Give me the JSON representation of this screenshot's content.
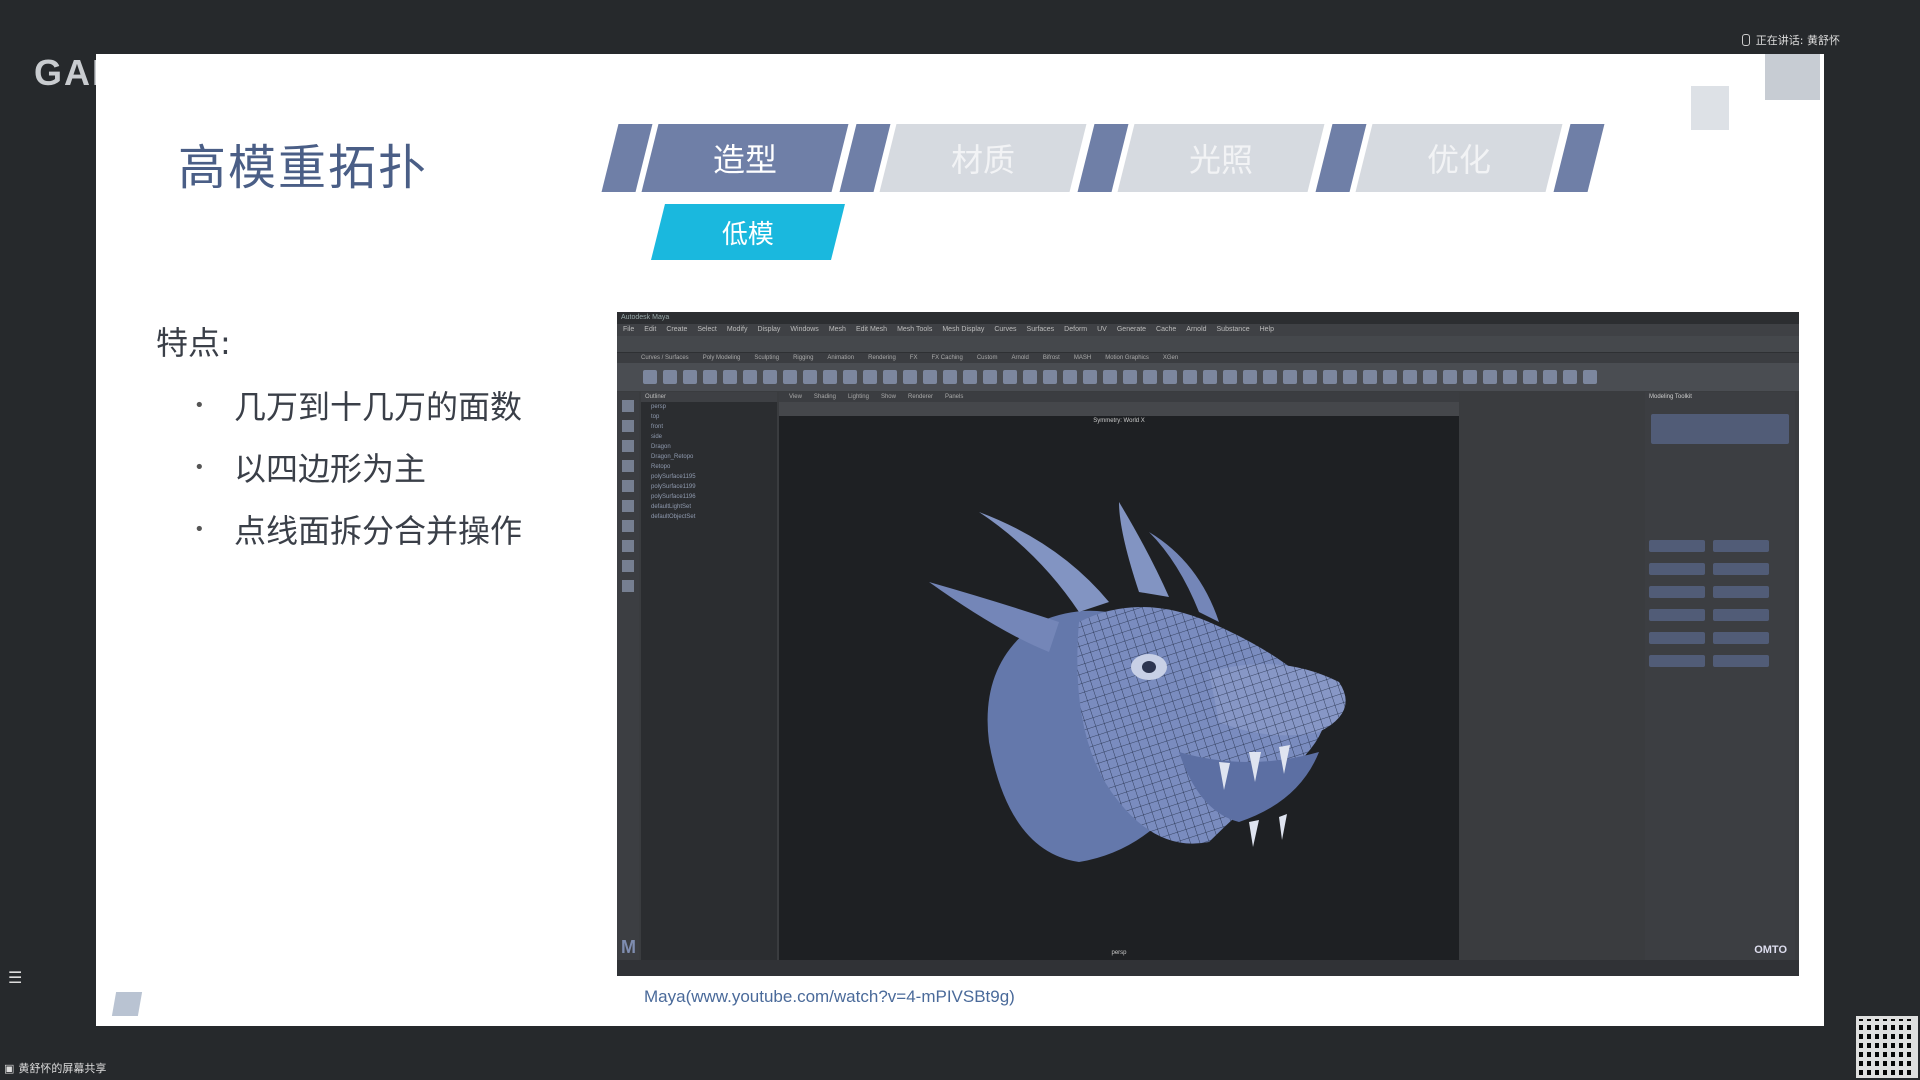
{
  "host": {
    "logo_text": "GAM"
  },
  "status": {
    "speaking": "正在讲话: 黄舒怀"
  },
  "share": {
    "label": "黄舒怀的屏幕共享"
  },
  "slide": {
    "title": "高模重拓扑",
    "tabs": [
      {
        "label": "造型",
        "active": true
      },
      {
        "label": "材质",
        "active": false
      },
      {
        "label": "光照",
        "active": false
      },
      {
        "label": "优化",
        "active": false
      }
    ],
    "subtab": "低模",
    "features_heading": "特点:",
    "features": [
      "几万到十几万的面数",
      "以四边形为主",
      "点线面拆分合并操作"
    ],
    "caption": "Maya(www.youtube.com/watch?v=4-mPIVSBt9g)",
    "colors": {
      "title": "#4a5e86",
      "tab_active": "#6f7fa7",
      "tab_inactive": "#d6dae0",
      "subtab": "#1ab8de"
    }
  },
  "maya": {
    "menu": [
      "File",
      "Edit",
      "Create",
      "Select",
      "Modify",
      "Display",
      "Windows",
      "Mesh",
      "Edit Mesh",
      "Mesh Tools",
      "Mesh Display",
      "Curves",
      "Surfaces",
      "Deform",
      "UV",
      "Generate",
      "Cache",
      "Arnold",
      "Substance",
      "Help"
    ],
    "shelf_tabs": [
      "Curves / Surfaces",
      "Poly Modeling",
      "Sculpting",
      "Rigging",
      "Animation",
      "Rendering",
      "FX",
      "FX Caching",
      "Custom",
      "Arnold",
      "Bifrost",
      "MASH",
      "Motion Graphics",
      "XGen"
    ],
    "outliner_items": [
      "persp",
      "top",
      "front",
      "side",
      "Dragon",
      "Dragon_Retopo",
      "Retopo",
      "polySurface1195",
      "polySurface1199",
      "polySurface1196",
      "defaultLightSet",
      "defaultObjectSet"
    ],
    "viewport_menu": [
      "View",
      "Shading",
      "Lighting",
      "Show",
      "Renderer",
      "Panels"
    ],
    "hud_symmetry": "Symmetry: World X",
    "camera": "persp",
    "toolkit_title": "Modeling Toolkit",
    "watermark": "OMTO",
    "app_logo": "M"
  }
}
